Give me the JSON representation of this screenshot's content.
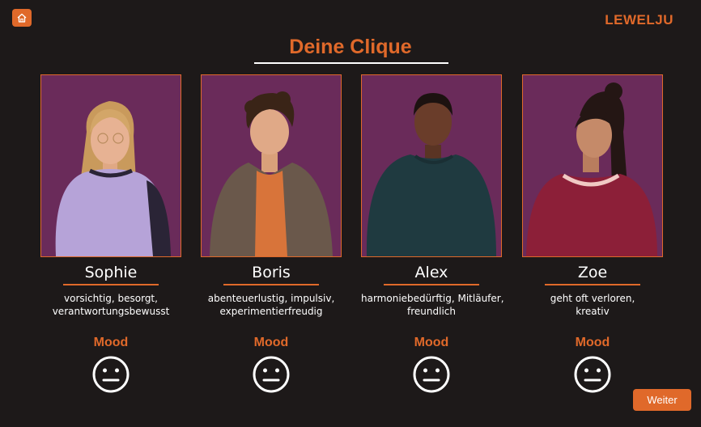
{
  "header": {
    "home_icon": "home-icon",
    "brand": "LEWELJU",
    "title": "Deine Clique"
  },
  "colors": {
    "accent": "#e0692a",
    "background": "#1d1919",
    "portrait_bg": "#6a2b5a"
  },
  "cards": [
    {
      "name": "Sophie",
      "traits_line1": "vorsichtig, besorgt,",
      "traits_line2": "verantwortungsbewusst",
      "mood_label": "Mood",
      "mood_icon": "neutral-face-icon"
    },
    {
      "name": "Boris",
      "traits_line1": "abenteuerlustig, impulsiv,",
      "traits_line2": "experimentierfreudig",
      "mood_label": "Mood",
      "mood_icon": "neutral-face-icon"
    },
    {
      "name": "Alex",
      "traits_line1": "harmoniebedürftig, Mitläufer,",
      "traits_line2": "freundlich",
      "mood_label": "Mood",
      "mood_icon": "neutral-face-icon"
    },
    {
      "name": "Zoe",
      "traits_line1": "geht oft verloren,",
      "traits_line2": "kreativ",
      "mood_label": "Mood",
      "mood_icon": "neutral-face-icon"
    }
  ],
  "footer": {
    "next_label": "Weiter"
  }
}
